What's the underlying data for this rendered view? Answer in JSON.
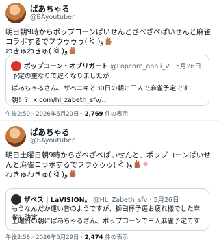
{
  "post1": {
    "name": "ぱあちゃる",
    "handle": "@BAyoutuber",
    "text": "明日朝9時からポップコーンぱいせんとざべざべぱいせんと麻雀コラボするでフウゥゥゥ( ᐛ )و",
    "text2": "わきゅわきゅ( ᐛ )و",
    "quote": {
      "name": "ポップコーン・オブリガート",
      "handle": "@Popcorn_obbli_V",
      "date": "5月26日",
      "lines": [
        "予定の重なりで遅くなりましたが",
        "ぱあちゃるさん、ザベニキと30日の朝に三人で麻雀予定です",
        "朝！？ x.com/hl_zabeth_sfv/…"
      ]
    },
    "time": "午後2:59 · 2026年5月29日 · ",
    "views": "2,769",
    "views_suffix": "件の表示"
  },
  "post2": {
    "name": "ぱあちゃる",
    "handle": "@BAyoutuber",
    "text": "明日土曜日朝9時からざべざべぱいせんと、ポップコーンぱいせんと麻雀コラボするでフウゥゥゥ( ᐛ )و",
    "text2": "わきゅわきゅ( ᐛ )و",
    "quote": {
      "name": "ザベス | LaVISION。",
      "handle": "@HL_Zabeth_sfv",
      "date": "5月26日",
      "lines": [
        "もうなんだか遠い昔のようですが、獅臼杯予選お疲れ様でした麻雀も決定",
        "土曜日の朝にぱあちゃるさん、ポップコーンで三人麻雀予定です"
      ]
    },
    "time": "午後2:58 · 2026年5月29日 · ",
    "views": "2,474",
    "views_suffix": "件の表示"
  },
  "icons": [
    "avatar",
    "hand-emoji",
    "flower-emoji"
  ],
  "colors": {
    "text": "#0f1419",
    "muted": "#536471",
    "border": "#cfd9de"
  }
}
